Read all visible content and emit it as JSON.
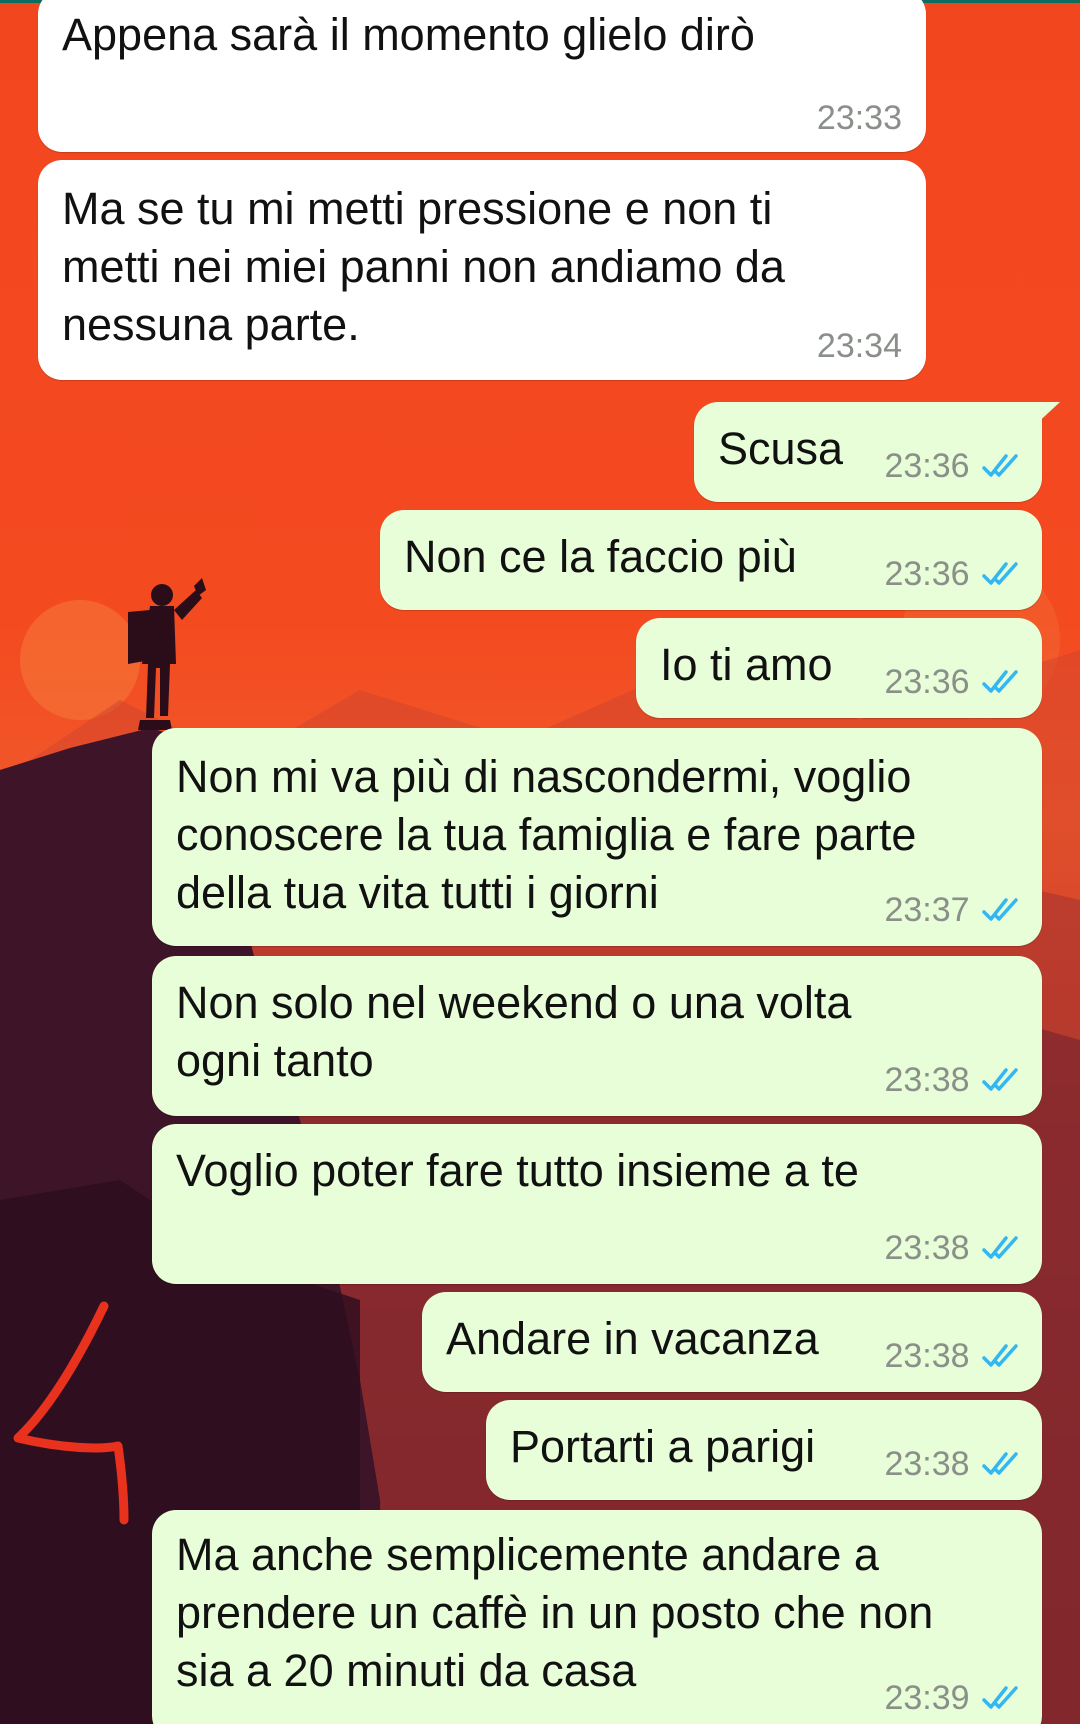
{
  "colors": {
    "incoming_bubble": "#ffffff",
    "outgoing_bubble": "#e7fed8",
    "read_ticks": "#34b7f1",
    "timestamp": "#8a8f8a",
    "annotation_stroke": "#e8321e"
  },
  "messages": [
    {
      "direction": "in",
      "text": "Appena sarà il momento glielo dirò",
      "time": "23:33"
    },
    {
      "direction": "in",
      "text": "Ma se tu mi metti pressione e non ti\nmetti nei miei panni non andiamo da\nnessuna parte.",
      "time": "23:34"
    },
    {
      "direction": "out",
      "text": "Scusa",
      "time": "23:36",
      "status": "read"
    },
    {
      "direction": "out",
      "text": "Non ce la faccio più",
      "time": "23:36",
      "status": "read"
    },
    {
      "direction": "out",
      "text": "Io ti amo",
      "time": "23:36",
      "status": "read"
    },
    {
      "direction": "out",
      "text": "Non mi va più di nascondermi, voglio\nconoscere la tua famiglia e fare parte\ndella tua vita tutti i giorni",
      "time": "23:37",
      "status": "read"
    },
    {
      "direction": "out",
      "text": "Non solo nel weekend o una volta\nogni tanto",
      "time": "23:38",
      "status": "read"
    },
    {
      "direction": "out",
      "text": "Voglio poter fare tutto insieme a te",
      "time": "23:38",
      "status": "read"
    },
    {
      "direction": "out",
      "text": "Andare in vacanza",
      "time": "23:38",
      "status": "read"
    },
    {
      "direction": "out",
      "text": "Portarti a parigi",
      "time": "23:38",
      "status": "read"
    },
    {
      "direction": "out",
      "text": "Ma anche semplicemente andare a\nprendere un caffè in un posto che non\nsia a 20 minuti da casa",
      "time": "23:39",
      "status": "read"
    }
  ]
}
